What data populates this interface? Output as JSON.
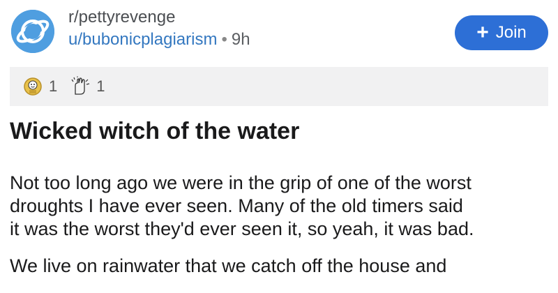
{
  "post": {
    "subreddit": "r/pettyrevenge",
    "username": "u/bubonicplagiarism",
    "separator": "•",
    "age": "9h",
    "title": "Wicked witch of the water",
    "body": {
      "paragraph1_lines": [
        "Not too long ago we were in the grip of one of the worst",
        "droughts I have ever seen. Many of the old timers said",
        "it was the worst they'd ever seen it, so yeah, it was bad."
      ],
      "paragraph2_lines": [
        "We live on rainwater that we catch off the house and"
      ]
    }
  },
  "join_button": {
    "icon": "plus-icon",
    "label": "Join"
  },
  "awards": [
    {
      "icon": "gold-award-icon",
      "count": "1"
    },
    {
      "icon": "clapping-hands-award-icon",
      "count": "1"
    }
  ],
  "colors": {
    "accent": "#2d6fd6",
    "avatar": "#4f9ee0",
    "username": "#3478c0",
    "awards_bg": "#f1f1f2"
  }
}
